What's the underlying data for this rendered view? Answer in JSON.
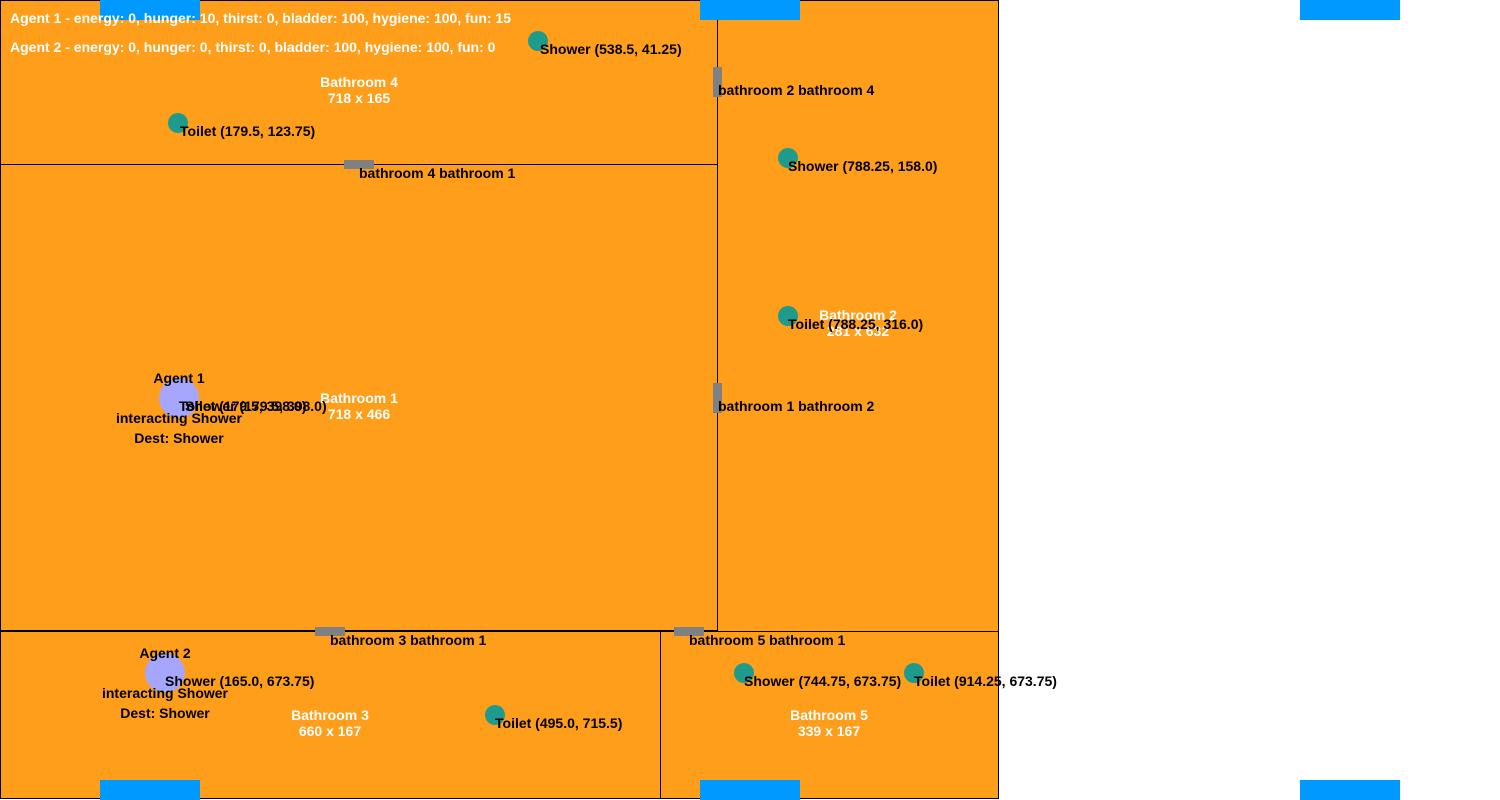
{
  "colors": {
    "room_fill": "#ff9e1a",
    "wall": "#000000",
    "door": "#808080",
    "object": "#1f9b8e",
    "agent": "#a6a6ff",
    "bar": "#0099ff",
    "label_text": "#ffffff"
  },
  "hud": [
    "Agent 1 - energy: 0, hunger: 10, thirst: 0, bladder: 100, hygiene: 100, fun: 15",
    "Agent 2 - energy: 0, hunger: 0, thirst: 0, bladder: 100, hygiene: 100, fun: 0"
  ],
  "rooms": [
    {
      "name": "Bathroom 4",
      "size": "718 x 165"
    },
    {
      "name": "Bathroom 1",
      "size": "718 x 466"
    },
    {
      "name": "Bathroom 2",
      "size": "281 x 632"
    },
    {
      "name": "Bathroom 3",
      "size": "660 x 167"
    },
    {
      "name": "Bathroom 5",
      "size": "339 x 167"
    }
  ],
  "doors": [
    {
      "label": "bathroom 2 bathroom 4"
    },
    {
      "label": "bathroom 4 bathroom 1"
    },
    {
      "label": "bathroom 1 bathroom 2"
    },
    {
      "label": "bathroom 3 bathroom 1"
    },
    {
      "label": "bathroom 5 bathroom 1"
    }
  ],
  "objects": [
    {
      "label": "Shower (538.5, 41.25)",
      "icon": "shower-icon"
    },
    {
      "label": "Toilet (179.5, 123.75)",
      "icon": "toilet-icon"
    },
    {
      "label": "Shower (788.25, 158.0)",
      "icon": "shower-icon"
    },
    {
      "label": "Toilet (788.25, 316.0)",
      "icon": "toilet-icon"
    },
    {
      "label": "Toilet (179.5, 398.0)",
      "icon": "toilet-icon"
    },
    {
      "label": "Shower (179.5, 398.0)",
      "icon": "shower-icon"
    },
    {
      "label": "Shower (165.0, 673.75)",
      "icon": "shower-icon"
    },
    {
      "label": "Toilet (495.0, 715.5)",
      "icon": "toilet-icon"
    },
    {
      "label": "Shower (744.75, 673.75)",
      "icon": "shower-icon"
    },
    {
      "label": "Toilet (914.25, 673.75)",
      "icon": "toilet-icon"
    }
  ],
  "agents": [
    {
      "name": "Agent 1",
      "status": "interacting Shower",
      "dest": "Dest: Shower"
    },
    {
      "name": "Agent 2",
      "status": "interacting Shower",
      "dest": "Dest: Shower"
    }
  ]
}
